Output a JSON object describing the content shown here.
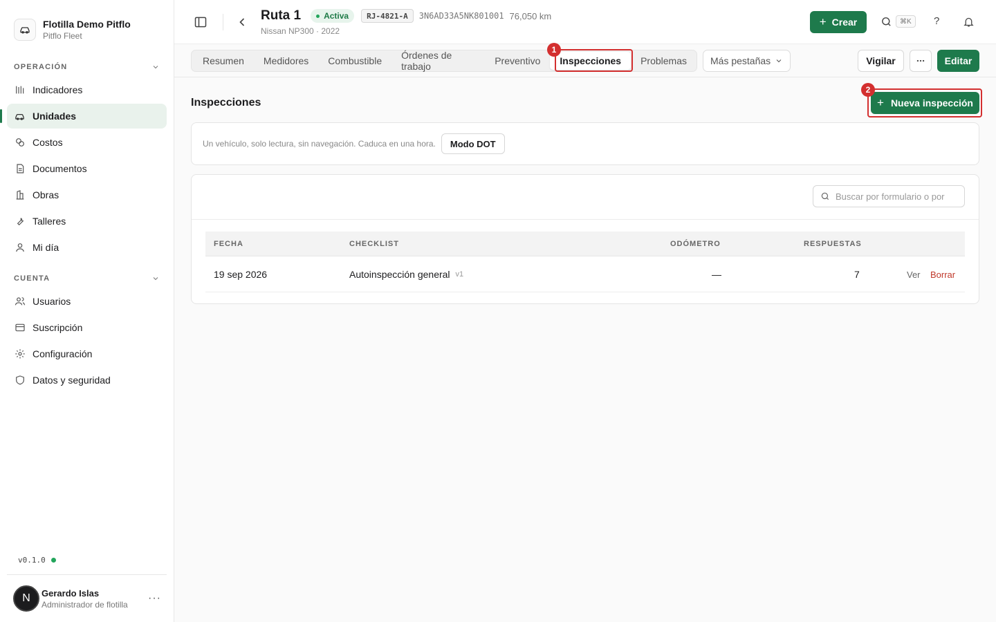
{
  "brand": {
    "name": "Flotilla Demo Pitflo",
    "subtitle": "Pitflo Fleet"
  },
  "sidebar": {
    "sections": [
      {
        "title": "OPERACIÓN",
        "items": [
          {
            "label": "Indicadores",
            "icon": "chart-bars-icon"
          },
          {
            "label": "Unidades",
            "icon": "car-icon",
            "active": true
          },
          {
            "label": "Costos",
            "icon": "coins-icon"
          },
          {
            "label": "Documentos",
            "icon": "document-icon"
          },
          {
            "label": "Obras",
            "icon": "building-icon"
          },
          {
            "label": "Talleres",
            "icon": "wrench-icon"
          },
          {
            "label": "Mi día",
            "icon": "user-icon"
          }
        ]
      },
      {
        "title": "CUENTA",
        "items": [
          {
            "label": "Usuarios",
            "icon": "users-icon"
          },
          {
            "label": "Suscripción",
            "icon": "credit-card-icon"
          },
          {
            "label": "Configuración",
            "icon": "gear-icon"
          },
          {
            "label": "Datos y seguridad",
            "icon": "shield-icon"
          }
        ]
      }
    ],
    "version": "v0.1.0",
    "user": {
      "initial": "N",
      "name": "Gerardo Islas",
      "role": "Administrador de flotilla"
    }
  },
  "header": {
    "title": "Ruta 1",
    "status": "Activa",
    "plate": "RJ-4821-A",
    "vin": "3N6AD33A5NK801001",
    "odometer": "76,050 km",
    "subtitle": "Nissan NP300 · 2022",
    "create_label": "Crear",
    "shortcut": "⌘K",
    "help": "?"
  },
  "tabs": {
    "items": [
      "Resumen",
      "Medidores",
      "Combustible",
      "Órdenes de trabajo",
      "Preventivo",
      "Inspecciones",
      "Problemas"
    ],
    "active_index": 5,
    "more_label": "Más pestañas",
    "watch_label": "Vigilar",
    "edit_label": "Editar"
  },
  "annotations": {
    "one": "1",
    "two": "2"
  },
  "content": {
    "title": "Inspecciones",
    "new_button": "Nueva inspección",
    "dot_text": "Un vehículo, solo lectura, sin navegación. Caduca en una hora.",
    "dot_button": "Modo DOT",
    "search_placeholder": "Buscar por formulario o por",
    "columns": [
      "FECHA",
      "CHECKLIST",
      "ODÓMETRO",
      "RESPUESTAS"
    ],
    "rows": [
      {
        "date": "19 sep 2026",
        "checklist": "Autoinspección general",
        "version": "v1",
        "odometer": "—",
        "answers": "7",
        "view": "Ver",
        "delete": "Borrar"
      }
    ]
  },
  "colors": {
    "accent": "#1e7a4c",
    "annotation": "#d32f2f",
    "danger": "#c0392b"
  }
}
